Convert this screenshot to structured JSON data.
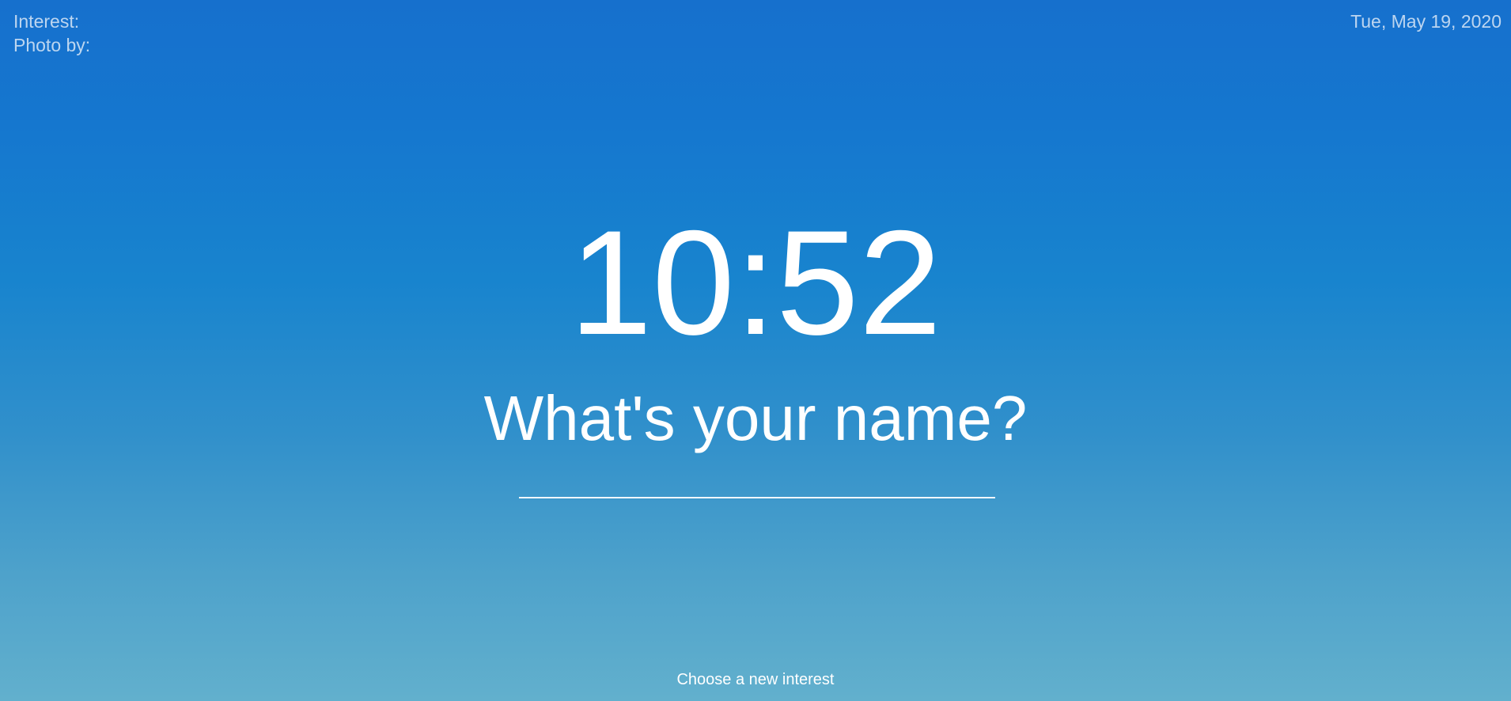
{
  "meta": {
    "interest_label": "Interest:",
    "photo_label": "Photo by:"
  },
  "date": "Tue, May 19, 2020",
  "clock": {
    "time": "10:52"
  },
  "greeting": {
    "prompt": "What's your name?"
  },
  "name_input": {
    "value": "",
    "placeholder": ""
  },
  "footer": {
    "choose_interest_label": "Choose a new interest"
  },
  "colors": {
    "background_top": "#1670cd",
    "background_bottom": "#62b0cd",
    "text": "#ffffff"
  }
}
